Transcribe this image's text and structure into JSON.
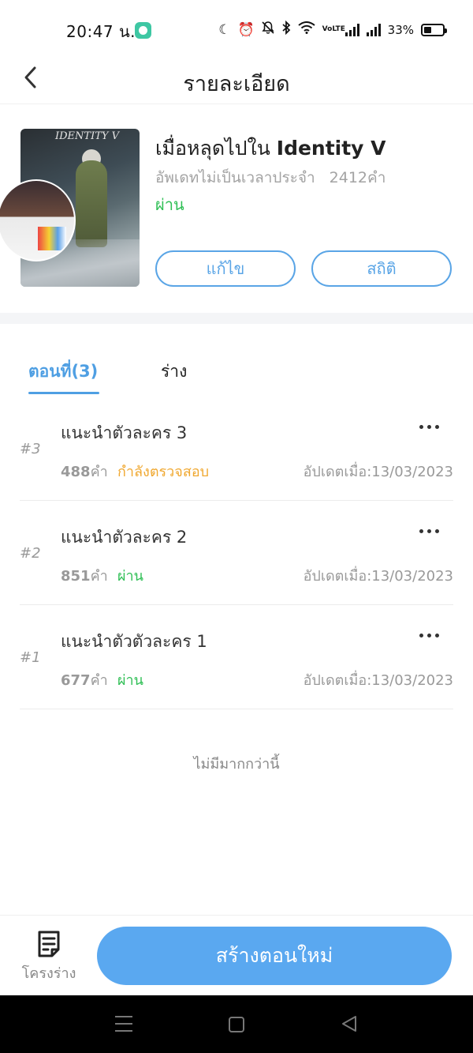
{
  "status_bar": {
    "time": "20:47 น.",
    "battery": "33%",
    "volte": "VoLTE"
  },
  "header": {
    "title": "รายละเอียด"
  },
  "book": {
    "title_thai": "เมื่อหลุดไปใน ",
    "title_latin": "Identity V",
    "update_schedule": "อัพเดทไม่เป็นเวลาประจำ",
    "word_count": "2412คำ",
    "status": "ผ่าน",
    "cover_logo": "IDENTITY V",
    "edit_button": "แก้ไข",
    "stats_button": "สถิติ"
  },
  "tabs": {
    "episodes": "ตอนที่(3)",
    "drafts": "ร่าง"
  },
  "chapters": [
    {
      "number": "#3",
      "title": "แนะนำตัวละคร 3",
      "words": "488",
      "words_unit": "คำ",
      "status": "กำลังตรวจสอบ",
      "status_color": "#f0a830",
      "updated": "อัปเดตเมื่อ:13/03/2023"
    },
    {
      "number": "#2",
      "title": "แนะนำตัวละคร 2",
      "words": "851",
      "words_unit": "คำ",
      "status": "ผ่าน",
      "status_color": "#2fbf55",
      "updated": "อัปเดตเมื่อ:13/03/2023"
    },
    {
      "number": "#1",
      "title": "แนะนำตัวตัวละคร 1",
      "words": "677",
      "words_unit": "คำ",
      "status": "ผ่าน",
      "status_color": "#2fbf55",
      "updated": "อัปเดตเมื่อ:13/03/2023"
    }
  ],
  "list_end_text": "ไม่มีมากกว่านี้",
  "bottom_bar": {
    "outline_label": "โครงร่าง",
    "create_button": "สร้างตอนใหม่"
  },
  "colors": {
    "accent": "#5aa5e6",
    "pass_green": "#2fbf55",
    "review_orange": "#f0a830"
  }
}
